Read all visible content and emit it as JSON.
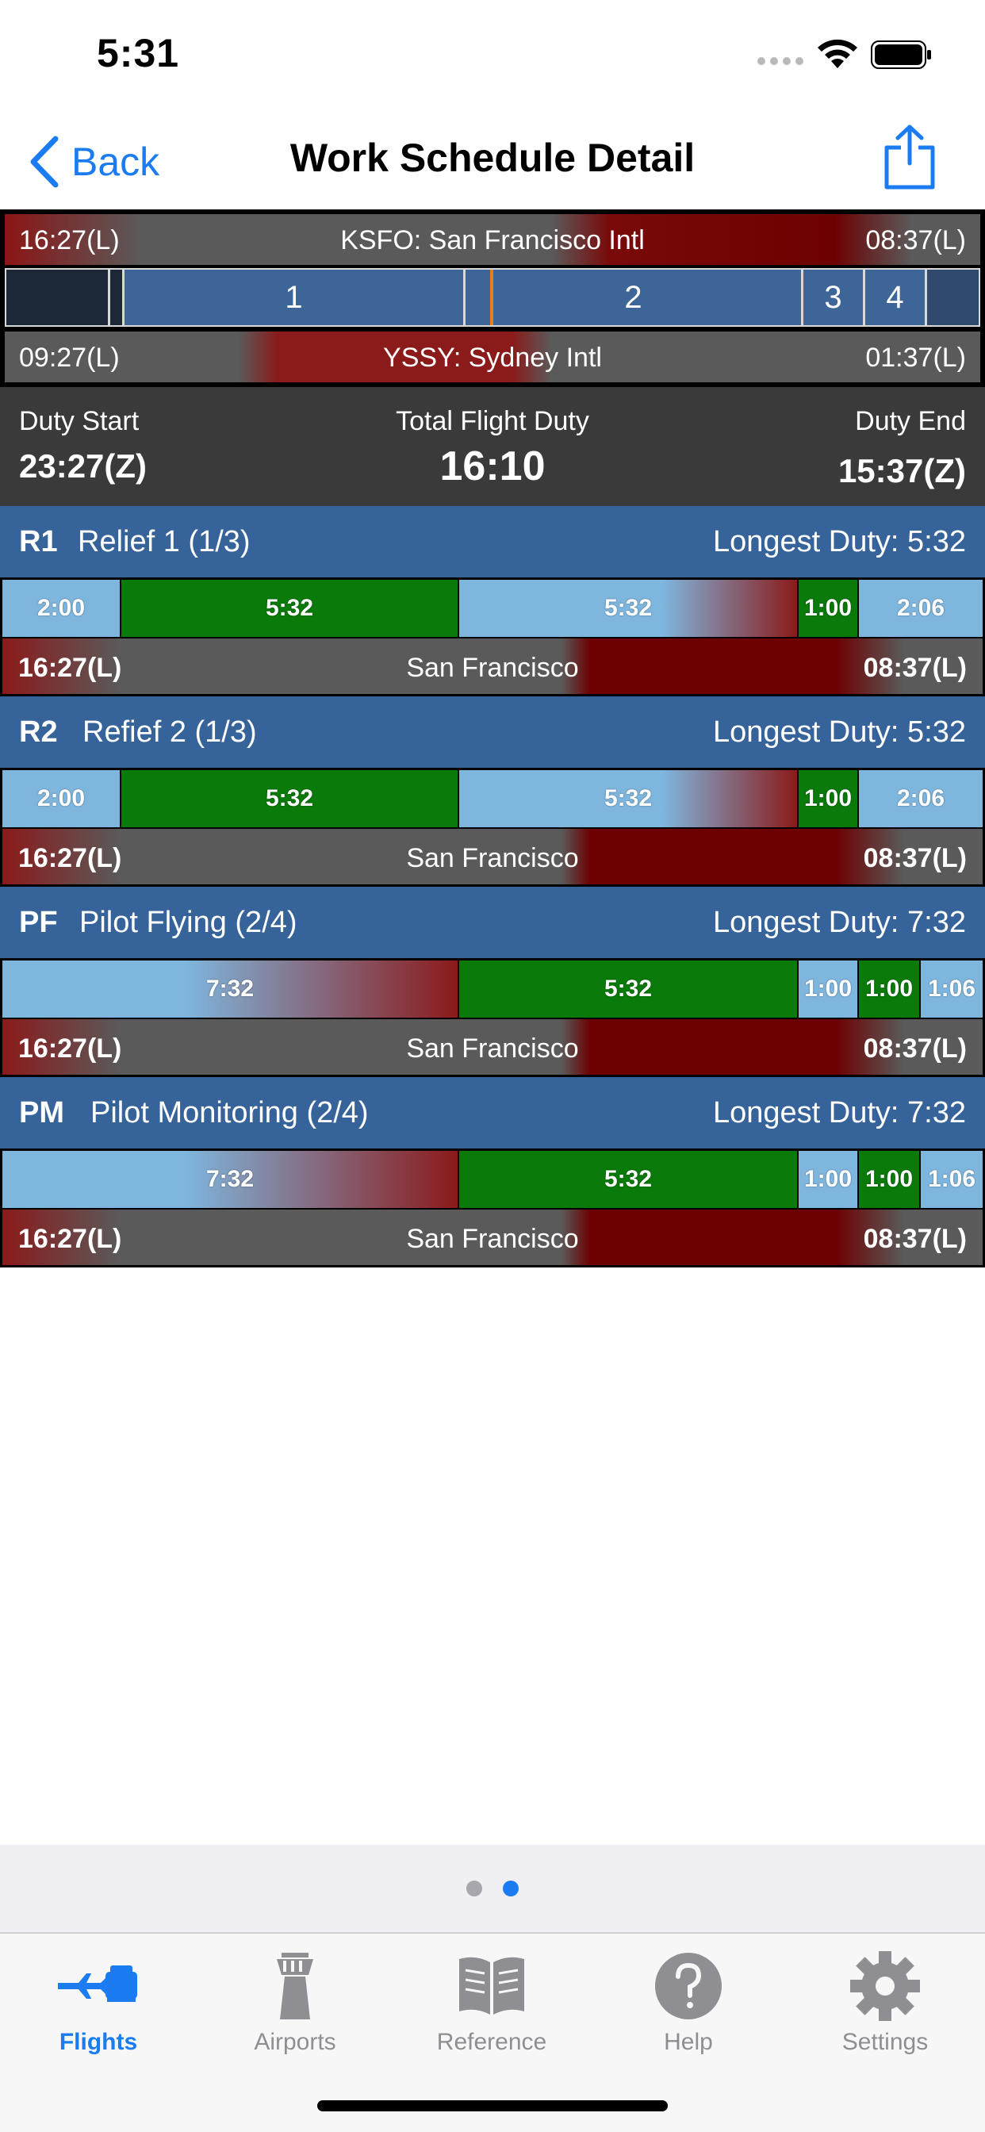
{
  "status": {
    "time": "5:31"
  },
  "nav": {
    "back_label": "Back",
    "title": "Work Schedule Detail"
  },
  "overview": {
    "origin_time": "16:27(L)",
    "origin_airport": "KSFO: San Francisco Intl",
    "origin_end_time": "08:37(L)",
    "segments": [
      "1",
      "2",
      "3",
      "4"
    ],
    "dest_time": "09:27(L)",
    "dest_airport": "YSSY: Sydney Intl",
    "dest_end_time": "01:37(L)"
  },
  "duty": {
    "start_label": "Duty Start",
    "start_value": "23:27(Z)",
    "total_label": "Total Flight Duty",
    "total_value": "16:10",
    "end_label": "Duty End",
    "end_value": "15:37(Z)"
  },
  "crew": [
    {
      "code": "R1",
      "name": "Relief 1 (1/3)",
      "longest": "Longest Duty: 5:32",
      "segments": [
        "2:00",
        "5:32",
        "5:32",
        "1:00",
        "2:06"
      ],
      "start_time": "16:27(L)",
      "location": "San Francisco",
      "end_time": "08:37(L)"
    },
    {
      "code": "R2",
      "name": "Refief 2 (1/3)",
      "longest": "Longest Duty: 5:32",
      "segments": [
        "2:00",
        "5:32",
        "5:32",
        "1:00",
        "2:06"
      ],
      "start_time": "16:27(L)",
      "location": "San Francisco",
      "end_time": "08:37(L)"
    },
    {
      "code": "PF",
      "name": "Pilot Flying (2/4)",
      "longest": "Longest Duty: 7:32",
      "segments": [
        "7:32",
        "5:32",
        "1:00",
        "1:00",
        "1:06"
      ],
      "start_time": "16:27(L)",
      "location": "San Francisco",
      "end_time": "08:37(L)"
    },
    {
      "code": "PM",
      "name": "Pilot Monitoring (2/4)",
      "longest": "Longest Duty: 7:32",
      "segments": [
        "7:32",
        "5:32",
        "1:00",
        "1:00",
        "1:06"
      ],
      "start_time": "16:27(L)",
      "location": "San Francisco",
      "end_time": "08:37(L)"
    }
  ],
  "tabs": [
    {
      "label": "Flights",
      "icon": "flights-icon",
      "active": true
    },
    {
      "label": "Airports",
      "icon": "airport-tower-icon",
      "active": false
    },
    {
      "label": "Reference",
      "icon": "book-icon",
      "active": false
    },
    {
      "label": "Help",
      "icon": "help-icon",
      "active": false
    },
    {
      "label": "Settings",
      "icon": "gear-icon",
      "active": false
    }
  ],
  "colors": {
    "accent": "#1a7cf0",
    "header_blue": "#36649a",
    "duty_green": "#0a7a0a",
    "rest_red": "#8b1a1a"
  }
}
